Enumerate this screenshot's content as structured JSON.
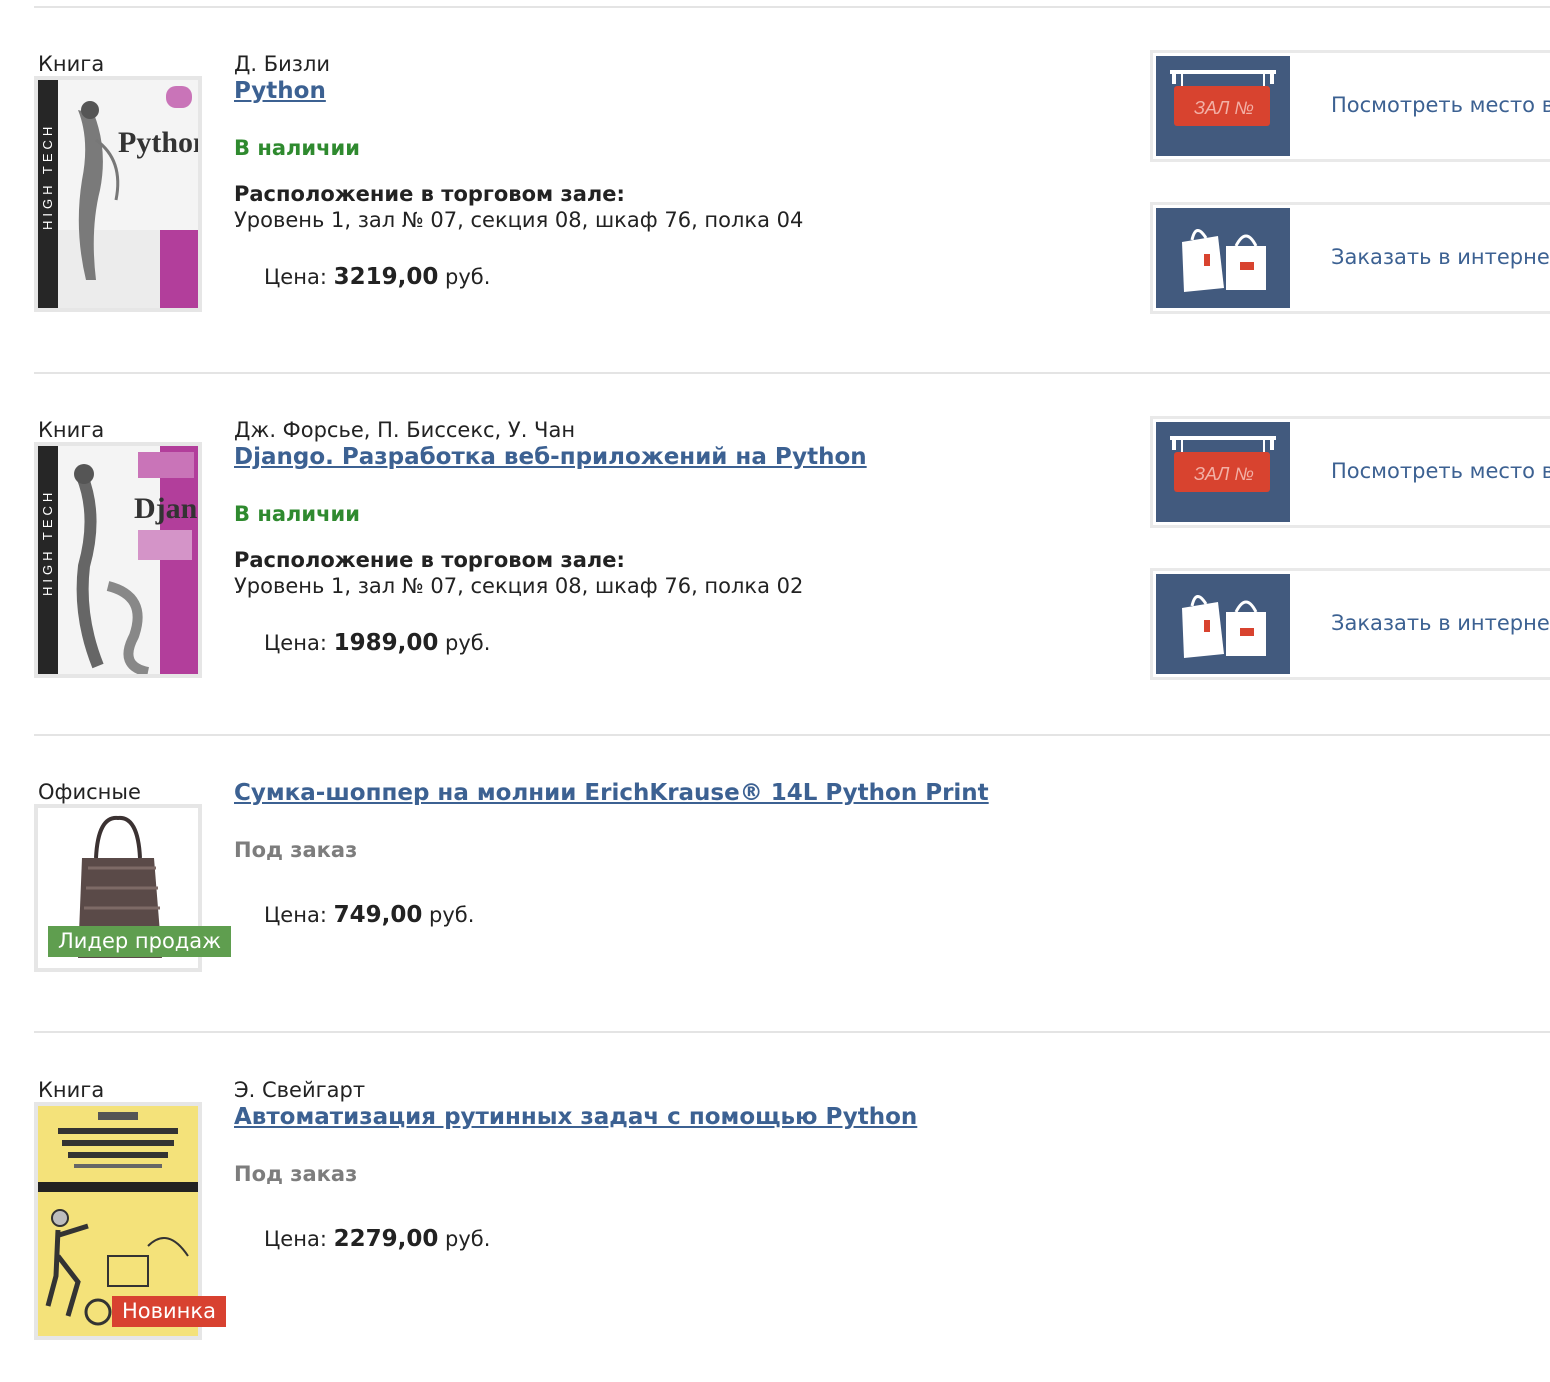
{
  "price_prefix": "Цена:",
  "currency": "руб.",
  "colors": {
    "link": "#3c6192",
    "in_stock": "#2f8a2f",
    "on_order": "#7d7d7d",
    "leader_badge": "#5f9e4f",
    "new_badge": "#d84130",
    "action_tile": "#425a7e"
  },
  "items": [
    {
      "category": "Книга",
      "cover_icon": "python-book-cover",
      "author": "Д. Бизли",
      "title": "Python",
      "status": "В наличии",
      "location_label": "Расположение в торговом зале:",
      "location": "Уровень 1, зал № 07, секция 08, шкаф 76, полка 04",
      "price": "3219,00",
      "actions": [
        {
          "label": "Посмотреть место в з",
          "icon": "hall-sign-icon"
        },
        {
          "label": "Заказать в интернет-",
          "icon": "shopping-bags-icon"
        }
      ]
    },
    {
      "category": "Книга",
      "cover_icon": "django-book-cover",
      "author": "Дж. Форсье, П. Биссекс, У. Чан",
      "title": "Django. Разработка веб-приложений на Python",
      "status": "В наличии",
      "location_label": "Расположение в торговом зале:",
      "location": "Уровень 1, зал № 07, секция 08, шкаф 76, полка 02",
      "price": "1989,00",
      "actions": [
        {
          "label": "Посмотреть место в з",
          "icon": "hall-sign-icon"
        },
        {
          "label": "Заказать в интернет-",
          "icon": "shopping-bags-icon"
        }
      ]
    },
    {
      "category": "Офисные",
      "cover_icon": "shopper-bag-photo",
      "author": "",
      "title": "Сумка-шоппер на молнии ErichKrause® 14L Python Print",
      "status": "Под заказ",
      "price": "749,00",
      "badge": "Лидер продаж"
    },
    {
      "category": "Книга",
      "cover_icon": "automation-book-cover",
      "author": "Э. Свейгарт",
      "title": "Автоматизация рутинных задач с помощью Python",
      "status": "Под заказ",
      "price": "2279,00",
      "badge": "Новинка"
    }
  ]
}
